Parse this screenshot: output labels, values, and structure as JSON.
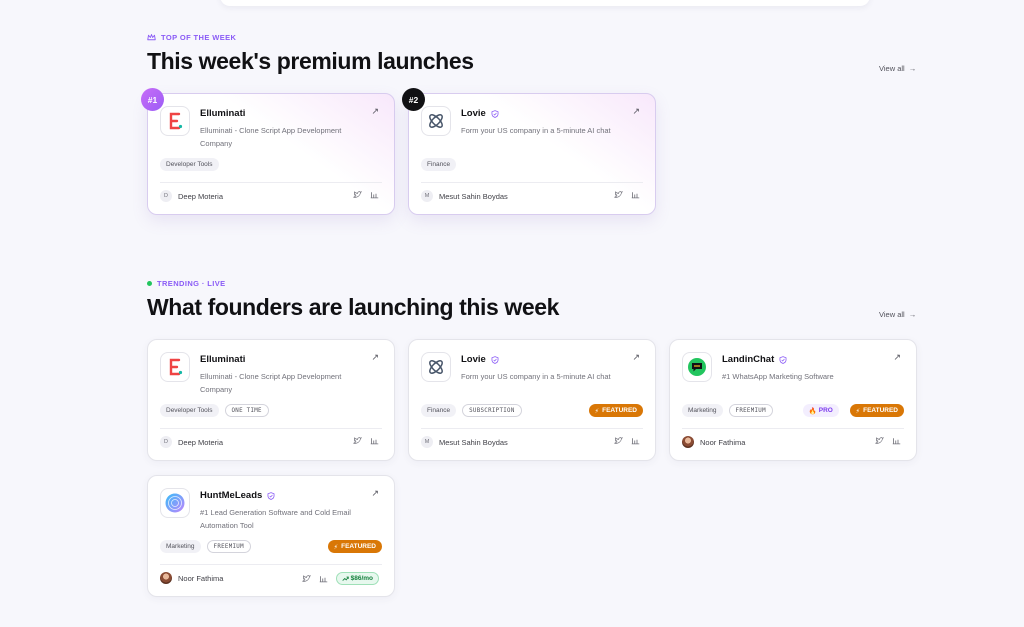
{
  "top_section": {
    "eyebrow": "TOP OF THE WEEK",
    "title": "This week's premium launches",
    "view_all": "View all",
    "cards": [
      {
        "rank": "#1",
        "name": "Elluminati",
        "verified": false,
        "desc": "Elluminati - Clone Script App Development Company",
        "tags": [
          "Developer Tools"
        ],
        "maker": "Deep Moteria",
        "maker_initial": "D"
      },
      {
        "rank": "#2",
        "name": "Lovie",
        "verified": true,
        "desc": "Form your US company in a 5-minute AI chat",
        "tags": [
          "Finance"
        ],
        "maker": "Mesut Sahin Boydas",
        "maker_initial": "M"
      }
    ]
  },
  "trending_section": {
    "eyebrow": "TRENDING · LIVE",
    "title": "What founders are launching this week",
    "view_all": "View all",
    "cards": [
      {
        "name": "Elluminati",
        "desc": "Elluminati - Clone Script App Development Company",
        "tag": "Developer Tools",
        "pricing": "ONE TIME",
        "maker": "Deep Moteria",
        "maker_initial": "D"
      },
      {
        "name": "Lovie",
        "desc": "Form your US company in a 5-minute AI chat",
        "tag": "Finance",
        "pricing": "SUBSCRIPTION",
        "featured": "FEATURED",
        "maker": "Mesut Sahin Boydas",
        "maker_initial": "M"
      },
      {
        "name": "LandinChat",
        "desc": "#1 WhatsApp Marketing Software",
        "tag": "Marketing",
        "pricing": "FREEMIUM",
        "pro": "PRO",
        "featured": "FEATURED",
        "maker": "Noor Fathima"
      },
      {
        "name": "HuntMeLeads",
        "desc": "#1 Lead Generation Software and Cold Email Automation Tool",
        "tag": "Marketing",
        "pricing": "FREEMIUM",
        "featured": "FEATURED",
        "maker": "Noor Fathima",
        "price": "$86/mo"
      }
    ]
  },
  "colors": {
    "accent": "#8b5cf6",
    "featured": "#d97706",
    "live": "#22c55e",
    "price": "#15803d"
  },
  "icons": [
    "crown-icon",
    "arrow-right-icon",
    "external-arrow-icon",
    "verified-shield-icon",
    "twitter-icon",
    "stats-icon",
    "bolt-icon",
    "trending-icon",
    "fire-icon"
  ]
}
